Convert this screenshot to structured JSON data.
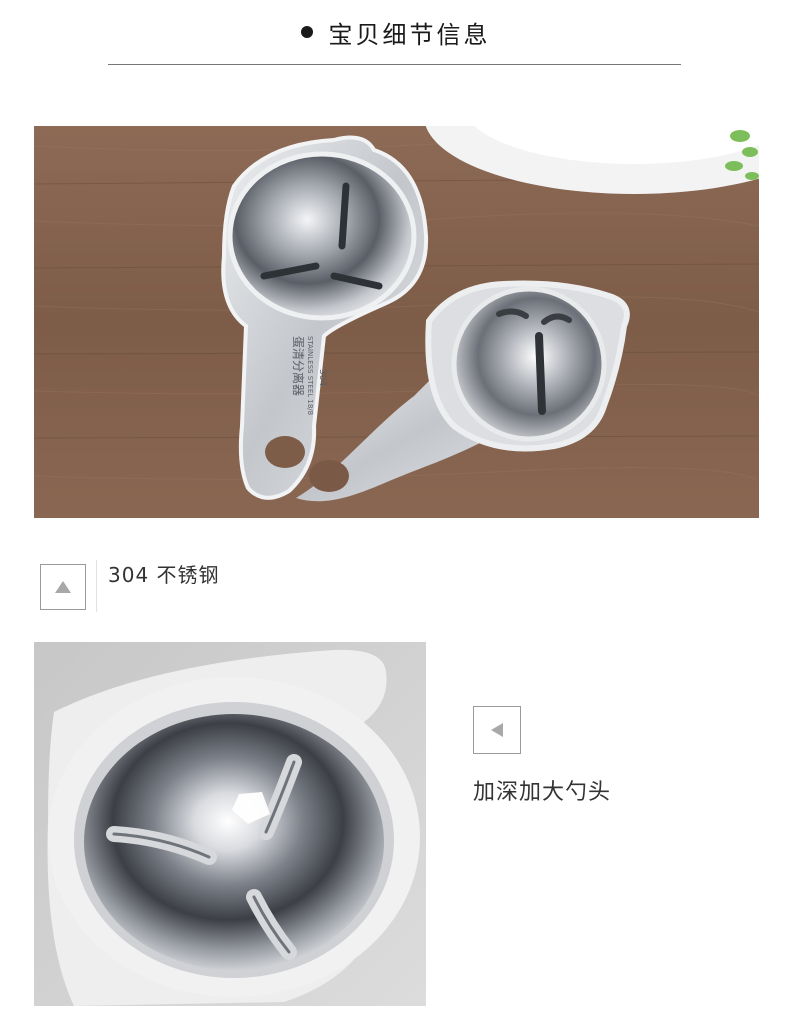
{
  "header": {
    "title": "宝贝细节信息"
  },
  "photos": {
    "top": {
      "engraving_line1": "蛋清分离器",
      "engraving_line2": "STAINLESS STEEL 18/8",
      "engraving_line3": "304"
    },
    "bottom": {}
  },
  "captions": {
    "material": "304 不锈钢",
    "spoon": "加深加大勺头"
  },
  "icons": {
    "header_bullet": "bullet-dot-icon",
    "caption1_arrow": "triangle-up-icon",
    "caption2_arrow": "triangle-left-icon"
  },
  "colors": {
    "wood": "#8a6650",
    "steel": "#c9ccd0",
    "text": "#333333"
  }
}
